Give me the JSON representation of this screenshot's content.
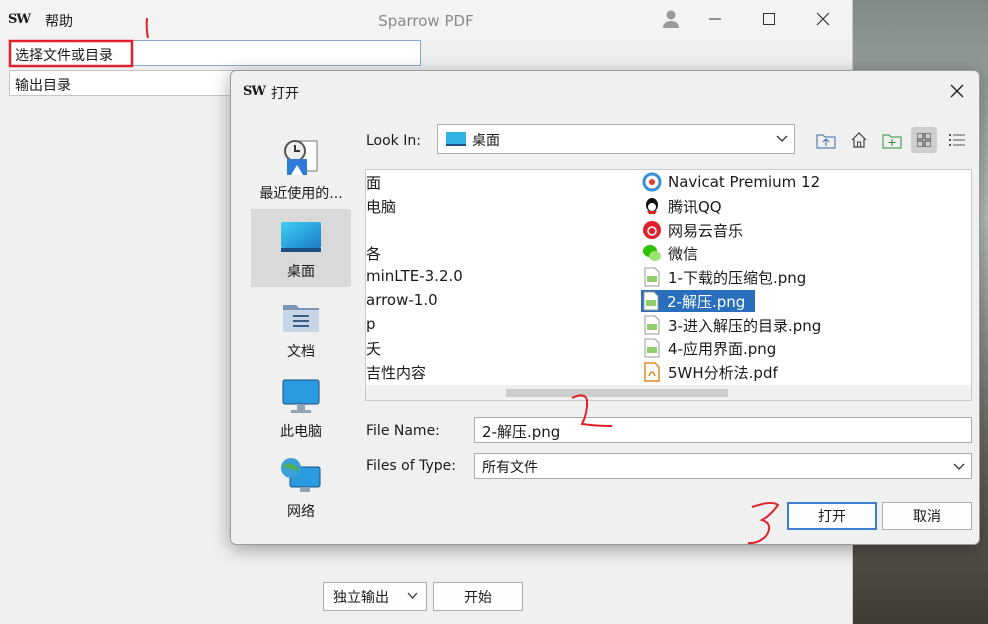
{
  "main": {
    "logo": "SW",
    "menu": [
      "帮助"
    ],
    "title": "Sparrow PDF",
    "select_input": "选择文件或目录",
    "output_input": "输出目录",
    "mode_select": "独立输出",
    "start_button": "开始"
  },
  "dialog": {
    "logo": "SW",
    "title": "打开",
    "sidebar": [
      {
        "label": "最近使用的...",
        "icon": "recent-icon"
      },
      {
        "label": "桌面",
        "icon": "desktop-icon"
      },
      {
        "label": "文档",
        "icon": "documents-icon"
      },
      {
        "label": "此电脑",
        "icon": "this-pc-icon"
      },
      {
        "label": "网络",
        "icon": "network-icon"
      }
    ],
    "lookin_label": "Look In:",
    "lookin_value": "桌面",
    "left_column": [
      "面",
      "电脑",
      "",
      "各",
      "minLTE-3.2.0",
      "arrow-1.0",
      "p",
      "夭",
      "吉性内容"
    ],
    "right_column": [
      {
        "name": "Navicat Premium 12",
        "icon": "navicat-icon"
      },
      {
        "name": "腾讯QQ",
        "icon": "qq-icon"
      },
      {
        "name": "网易云音乐",
        "icon": "netease-music-icon"
      },
      {
        "name": "微信",
        "icon": "wechat-icon"
      },
      {
        "name": "1-下载的压缩包.png",
        "icon": "image-file-icon"
      },
      {
        "name": "2-解压.png",
        "icon": "image-file-icon"
      },
      {
        "name": "3-进入解压的目录.png",
        "icon": "image-file-icon"
      },
      {
        "name": "4-应用界面.png",
        "icon": "image-file-icon"
      },
      {
        "name": "5WH分析法.pdf",
        "icon": "pdf-file-icon"
      }
    ],
    "selected_index": 5,
    "file_name_label": "File Name:",
    "file_name_value": "2-解压.png",
    "file_type_label": "Files of Type:",
    "file_type_value": "所有文件",
    "open_button": "打开",
    "cancel_button": "取消"
  },
  "colors": {
    "selection": "#2a6fbd",
    "annotation": "#e0202a"
  }
}
